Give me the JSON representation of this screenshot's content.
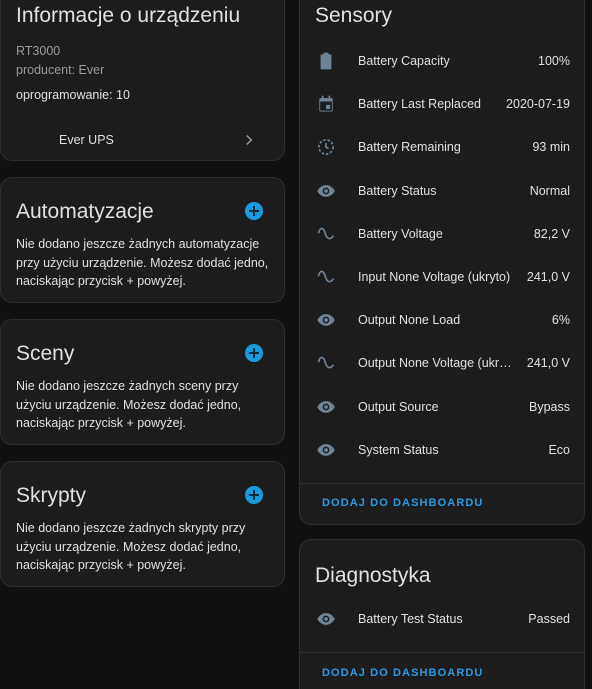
{
  "device_info": {
    "title": "Informacje o urządzeniu",
    "model": "RT3000",
    "manufacturer": "producent: Ever",
    "firmware": "oprogramowanie: 10",
    "link_label": "Ever UPS"
  },
  "automations": {
    "title": "Automatyzacje",
    "description": "Nie dodano jeszcze żadnych automatyzacje przy użyciu urządzenie. Możesz dodać jedno, naciskając przycisk + powyżej."
  },
  "scenes": {
    "title": "Sceny",
    "description": "Nie dodano jeszcze żadnych sceny przy użyciu urządzenie. Możesz dodać jedno, naciskając przycisk + powyżej."
  },
  "scripts": {
    "title": "Skrypty",
    "description": "Nie dodano jeszcze żadnych skrypty przy użyciu urządzenie. Możesz dodać jedno, naciskając przycisk + powyżej."
  },
  "sensors": {
    "title": "Sensory",
    "items": [
      {
        "icon": "battery-icon",
        "name": "Battery Capacity",
        "value": "100%"
      },
      {
        "icon": "calendar-icon",
        "name": "Battery Last Replaced",
        "value": "2020-07-19"
      },
      {
        "icon": "timer-icon",
        "name": "Battery Remaining",
        "value": "93 min"
      },
      {
        "icon": "eye-icon",
        "name": "Battery Status",
        "value": "Normal"
      },
      {
        "icon": "sine-wave-icon",
        "name": "Battery Voltage",
        "value": "82,2 V"
      },
      {
        "icon": "sine-wave-icon",
        "name": "Input None Voltage (ukryto)",
        "value": "241,0 V"
      },
      {
        "icon": "eye-icon",
        "name": "Output None Load",
        "value": "6%"
      },
      {
        "icon": "sine-wave-icon",
        "name": "Output None Voltage (ukryto)",
        "value": "241,0 V"
      },
      {
        "icon": "eye-icon",
        "name": "Output Source",
        "value": "Bypass"
      },
      {
        "icon": "eye-icon",
        "name": "System Status",
        "value": "Eco"
      }
    ],
    "add_label": "DODAJ DO DASHBOARDU"
  },
  "diagnostics": {
    "title": "Diagnostyka",
    "items": [
      {
        "icon": "eye-icon",
        "name": "Battery Test Status",
        "value": "Passed"
      }
    ],
    "add_label": "DODAJ DO DASHBOARDU"
  },
  "colors": {
    "background": "#111111",
    "card": "#1c1c1c",
    "accent": "#1a9be0",
    "icon": "#6f8597"
  }
}
